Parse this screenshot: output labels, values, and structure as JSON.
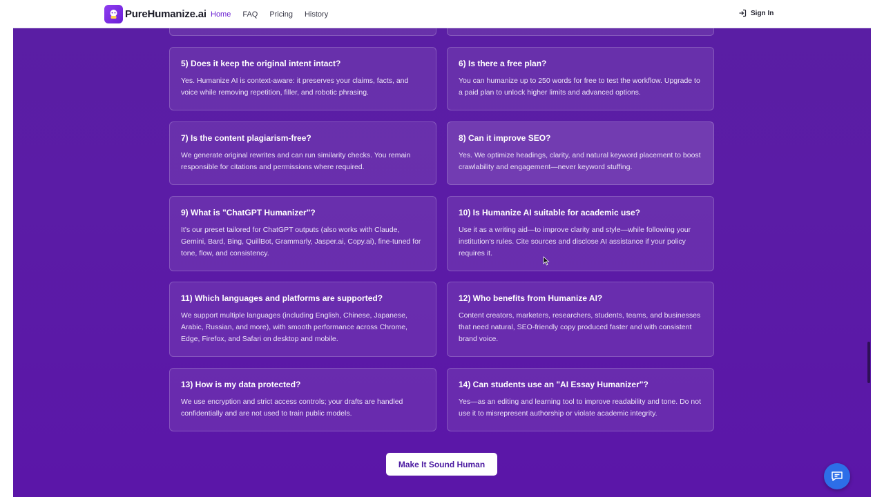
{
  "nav": {
    "brand": "PureHumanize.ai",
    "links": [
      {
        "label": "Home",
        "active": true
      },
      {
        "label": "FAQ",
        "active": false
      },
      {
        "label": "Pricing",
        "active": false
      },
      {
        "label": "History",
        "active": false
      }
    ],
    "signin": "Sign In"
  },
  "faq": [
    {
      "q": "5) Does it keep the original intent intact?",
      "a": "Yes. Humanize AI is context-aware: it preserves your claims, facts, and voice while removing repetition, filler, and robotic phrasing."
    },
    {
      "q": "6) Is there a free plan?",
      "a": "You can humanize up to 250 words for free to test the workflow. Upgrade to a paid plan to unlock higher limits and advanced options."
    },
    {
      "q": "7) Is the content plagiarism-free?",
      "a": "We generate original rewrites and can run similarity checks. You remain responsible for citations and permissions where required."
    },
    {
      "q": "8) Can it improve SEO?",
      "a": "Yes. We optimize headings, clarity, and natural keyword placement to boost crawlability and engagement—never keyword stuffing."
    },
    {
      "q": "9) What is \"ChatGPT Humanizer\"?",
      "a": "It's our preset tailored for ChatGPT outputs (also works with Claude, Gemini, Bard, Bing, QuillBot, Grammarly, Jasper.ai, Copy.ai), fine-tuned for tone, flow, and consistency."
    },
    {
      "q": "10) Is Humanize AI suitable for academic use?",
      "a": "Use it as a writing aid—to improve clarity and style—while following your institution's rules. Cite sources and disclose AI assistance if your policy requires it."
    },
    {
      "q": "11) Which languages and platforms are supported?",
      "a": "We support multiple languages (including English, Chinese, Japanese, Arabic, Russian, and more), with smooth performance across Chrome, Edge, Firefox, and Safari on desktop and mobile."
    },
    {
      "q": "12) Who benefits from Humanize AI?",
      "a": "Content creators, marketers, researchers, students, teams, and businesses that need natural, SEO-friendly copy produced faster and with consistent brand voice."
    },
    {
      "q": "13) How is my data protected?",
      "a": "We use encryption and strict access controls; your drafts are handled confidentially and are not used to train public models."
    },
    {
      "q": "14) Can students use an \"AI Essay Humanizer\"?",
      "a": "Yes—as an editing and learning tool to improve readability and tone. Do not use it to misrepresent authorship or violate academic integrity."
    }
  ],
  "cta": {
    "label": "Make It Sound Human"
  },
  "colors": {
    "accent": "#6a1fd1",
    "chat": "#2d6ee8"
  },
  "icons": {
    "signin": "sign-in-icon",
    "chat": "chat-bubble-icon",
    "logo": "logo-icon"
  }
}
